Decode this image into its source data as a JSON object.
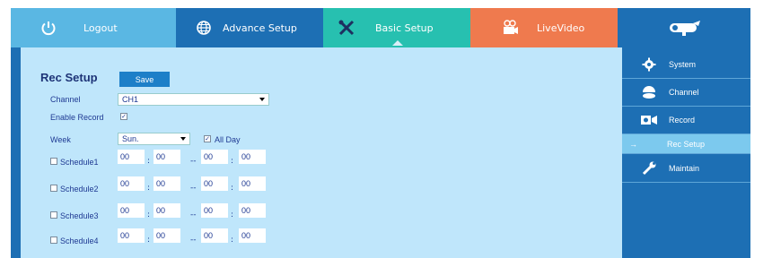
{
  "nav": {
    "logout": "Logout",
    "advance": "Advance Setup",
    "basic": "Basic Setup",
    "live": "LiveVideo",
    "logo_icon": "camera-logo-icon"
  },
  "page": {
    "title": "Rec Setup",
    "save": "Save",
    "channel_label": "Channel",
    "channel_value": "CH1",
    "enable_label": "Enable Record",
    "enable_checked": "✓",
    "week_label": "Week",
    "week_value": "Sun.",
    "allday_label": "All Day",
    "allday_checked": "✓",
    "separator": "--",
    "schedules": [
      {
        "label": "Schedule1",
        "t1": "00",
        "t2": "00",
        "t3": "00",
        "t4": "00"
      },
      {
        "label": "Schedule2",
        "t1": "00",
        "t2": "00",
        "t3": "00",
        "t4": "00"
      },
      {
        "label": "Schedule3",
        "t1": "00",
        "t2": "00",
        "t3": "00",
        "t4": "00"
      },
      {
        "label": "Schedule4",
        "t1": "00",
        "t2": "00",
        "t3": "00",
        "t4": "00"
      }
    ]
  },
  "sidebar": {
    "items": [
      {
        "label": "System",
        "icon": "gear-icon"
      },
      {
        "label": "Channel",
        "icon": "dome-camera-icon"
      },
      {
        "label": "Record",
        "icon": "video-camera-icon"
      },
      {
        "label": "Rec Setup",
        "icon": "arrow-right-icon"
      },
      {
        "label": "Maintain",
        "icon": "wrench-icon"
      }
    ]
  },
  "colors": {
    "accent": "#1d6fb4",
    "panel": "#bfe6fb",
    "basic_tab": "#27c0b0",
    "live_tab": "#ef7a4e",
    "logout_tab": "#5ab7e3"
  }
}
